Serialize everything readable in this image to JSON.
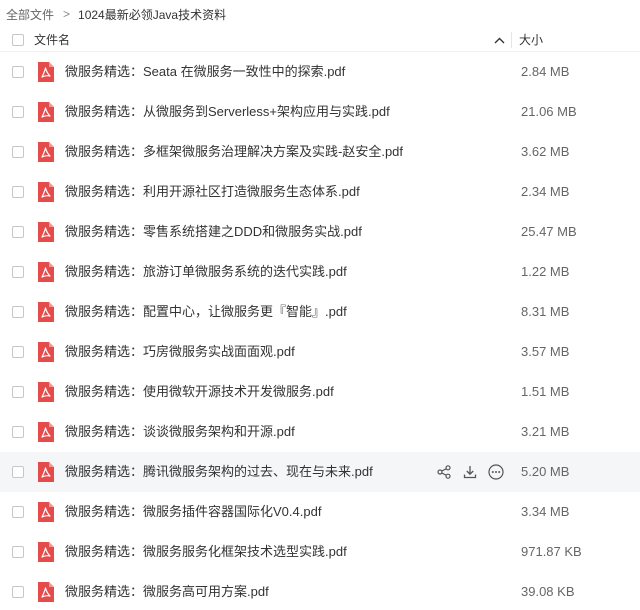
{
  "breadcrumb": {
    "root": "全部文件",
    "separator": ">",
    "current": "1024最新必领Java技术资料"
  },
  "header": {
    "name_col": "文件名",
    "size_col": "大小",
    "sort_icon": "chevron-up-icon"
  },
  "colors": {
    "pdf_icon": "#e64b4b",
    "hover_row": "#f5f6f8"
  },
  "files": [
    {
      "name": "微服务精选：Seata 在微服务一致性中的探索.pdf",
      "size": "2.84 MB"
    },
    {
      "name": "微服务精选：从微服务到Serverless+架构应用与实践.pdf",
      "size": "21.06 MB"
    },
    {
      "name": "微服务精选：多框架微服务治理解决方案及实践-赵安全.pdf",
      "size": "3.62 MB"
    },
    {
      "name": "微服务精选：利用开源社区打造微服务生态体系.pdf",
      "size": "2.34 MB"
    },
    {
      "name": "微服务精选：零售系统搭建之DDD和微服务实战.pdf",
      "size": "25.47 MB"
    },
    {
      "name": "微服务精选：旅游订单微服务系统的迭代实践.pdf",
      "size": "1.22 MB"
    },
    {
      "name": "微服务精选：配置中心，让微服务更『智能』.pdf",
      "size": "8.31 MB"
    },
    {
      "name": "微服务精选：巧房微服务实战面面观.pdf",
      "size": "3.57 MB"
    },
    {
      "name": "微服务精选：使用微软开源技术开发微服务.pdf",
      "size": "1.51 MB"
    },
    {
      "name": "微服务精选：谈谈微服务架构和开源.pdf",
      "size": "3.21 MB"
    },
    {
      "name": "微服务精选：腾讯微服务架构的过去、现在与未来.pdf",
      "size": "5.20 MB"
    },
    {
      "name": "微服务精选：微服务插件容器国际化V0.4.pdf",
      "size": "3.34 MB"
    },
    {
      "name": "微服务精选：微服务服务化框架技术选型实践.pdf",
      "size": "971.87 KB"
    },
    {
      "name": "微服务精选：微服务高可用方案.pdf",
      "size": "39.08 KB"
    }
  ],
  "hover_actions": [
    "share-icon",
    "download-icon",
    "more-icon"
  ]
}
